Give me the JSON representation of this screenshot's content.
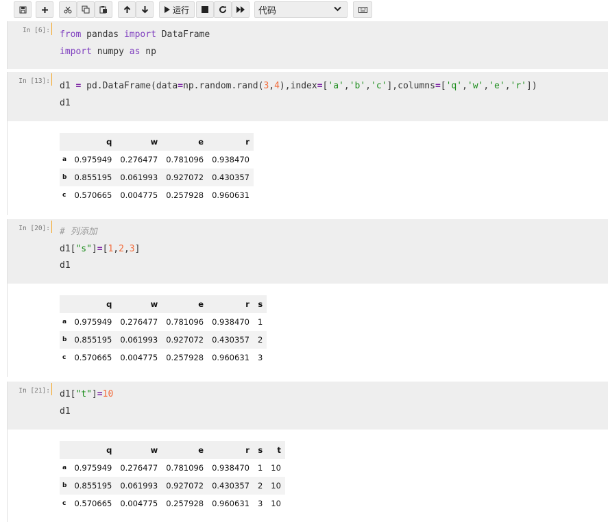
{
  "toolbar": {
    "run_label": "运行",
    "cell_type": "代码"
  },
  "cells": [
    {
      "prompt": "In [6]:",
      "code": [
        [
          {
            "t": "from",
            "c": "kw"
          },
          {
            "t": " pandas "
          },
          {
            "t": "import",
            "c": "kw"
          },
          {
            "t": " DataFrame"
          }
        ],
        [
          {
            "t": "import",
            "c": "kw"
          },
          {
            "t": " numpy "
          },
          {
            "t": "as",
            "c": "kw"
          },
          {
            "t": " np"
          }
        ]
      ]
    },
    {
      "prompt": "In [13]:",
      "code": [
        [
          {
            "t": "d1 "
          },
          {
            "t": "=",
            "c": "op"
          },
          {
            "t": " pd.DataFrame(data"
          },
          {
            "t": "=",
            "c": "op"
          },
          {
            "t": "np.random.rand("
          },
          {
            "t": "3",
            "c": "num"
          },
          {
            "t": ","
          },
          {
            "t": "4",
            "c": "num"
          },
          {
            "t": "),index"
          },
          {
            "t": "=",
            "c": "op"
          },
          {
            "t": "["
          },
          {
            "t": "'a'",
            "c": "str"
          },
          {
            "t": ","
          },
          {
            "t": "'b'",
            "c": "str"
          },
          {
            "t": ","
          },
          {
            "t": "'c'",
            "c": "str"
          },
          {
            "t": "],columns"
          },
          {
            "t": "=",
            "c": "op"
          },
          {
            "t": "["
          },
          {
            "t": "'q'",
            "c": "str"
          },
          {
            "t": ","
          },
          {
            "t": "'w'",
            "c": "str"
          },
          {
            "t": ","
          },
          {
            "t": "'e'",
            "c": "str"
          },
          {
            "t": ","
          },
          {
            "t": "'r'",
            "c": "str"
          },
          {
            "t": "])"
          }
        ],
        [
          {
            "t": "d1"
          }
        ]
      ],
      "output": {
        "columns": [
          "q",
          "w",
          "e",
          "r"
        ],
        "rows": [
          {
            "index": "a",
            "values": [
              "0.975949",
              "0.276477",
              "0.781096",
              "0.938470"
            ]
          },
          {
            "index": "b",
            "values": [
              "0.855195",
              "0.061993",
              "0.927072",
              "0.430357"
            ]
          },
          {
            "index": "c",
            "values": [
              "0.570665",
              "0.004775",
              "0.257928",
              "0.960631"
            ]
          }
        ]
      }
    },
    {
      "prompt": "In [20]:",
      "code": [
        [
          {
            "t": "# 列添加",
            "c": "cmt"
          }
        ],
        [
          {
            "t": "d1["
          },
          {
            "t": "\"s\"",
            "c": "str"
          },
          {
            "t": "]"
          },
          {
            "t": "=",
            "c": "op"
          },
          {
            "t": "["
          },
          {
            "t": "1",
            "c": "num"
          },
          {
            "t": ","
          },
          {
            "t": "2",
            "c": "num"
          },
          {
            "t": ","
          },
          {
            "t": "3",
            "c": "num"
          },
          {
            "t": "]"
          }
        ],
        [
          {
            "t": "d1"
          }
        ]
      ],
      "output": {
        "columns": [
          "q",
          "w",
          "e",
          "r",
          "s"
        ],
        "rows": [
          {
            "index": "a",
            "values": [
              "0.975949",
              "0.276477",
              "0.781096",
              "0.938470",
              "1"
            ]
          },
          {
            "index": "b",
            "values": [
              "0.855195",
              "0.061993",
              "0.927072",
              "0.430357",
              "2"
            ]
          },
          {
            "index": "c",
            "values": [
              "0.570665",
              "0.004775",
              "0.257928",
              "0.960631",
              "3"
            ]
          }
        ]
      }
    },
    {
      "prompt": "In [21]:",
      "code": [
        [
          {
            "t": "d1["
          },
          {
            "t": "\"t\"",
            "c": "str"
          },
          {
            "t": "]"
          },
          {
            "t": "=",
            "c": "op"
          },
          {
            "t": "10",
            "c": "num"
          }
        ],
        [
          {
            "t": "d1"
          }
        ]
      ],
      "output": {
        "columns": [
          "q",
          "w",
          "e",
          "r",
          "s",
          "t"
        ],
        "rows": [
          {
            "index": "a",
            "values": [
              "0.975949",
              "0.276477",
              "0.781096",
              "0.938470",
              "1",
              "10"
            ]
          },
          {
            "index": "b",
            "values": [
              "0.855195",
              "0.061993",
              "0.927072",
              "0.430357",
              "2",
              "10"
            ]
          },
          {
            "index": "c",
            "values": [
              "0.570665",
              "0.004775",
              "0.257928",
              "0.960631",
              "3",
              "10"
            ]
          }
        ]
      }
    }
  ]
}
